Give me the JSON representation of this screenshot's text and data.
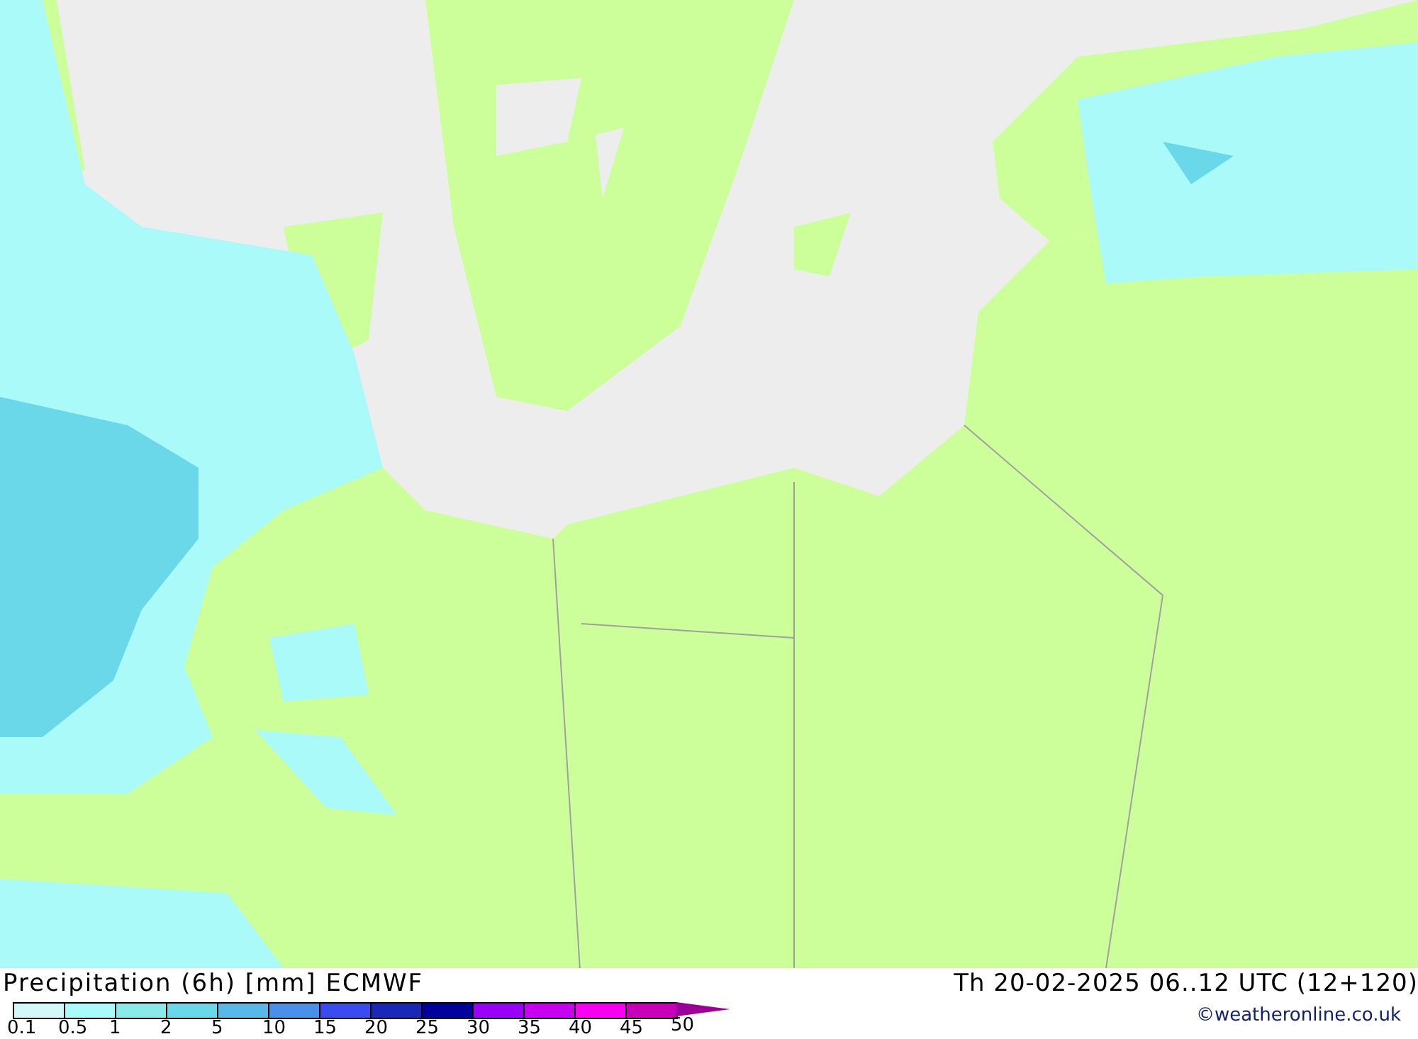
{
  "map": {
    "title": "Precipitation (6h) [mm] ECMWF",
    "valid_time": "Th 20-02-2025 06..12 UTC (12+120)"
  },
  "legend": [
    {
      "label": "0.1",
      "color": "#d2f8f8"
    },
    {
      "label": "0.5",
      "color": "#aafafa"
    },
    {
      "label": "1",
      "color": "#8aeaea"
    },
    {
      "label": "2",
      "color": "#6ad8e8"
    },
    {
      "label": "5",
      "color": "#5ab8e8"
    },
    {
      "label": "10",
      "color": "#4a90e8"
    },
    {
      "label": "15",
      "color": "#3a4cf0"
    },
    {
      "label": "20",
      "color": "#1a28b8"
    },
    {
      "label": "25",
      "color": "#00009a"
    },
    {
      "label": "30",
      "color": "#9a00f8"
    },
    {
      "label": "35",
      "color": "#c800f0"
    },
    {
      "label": "40",
      "color": "#f800f0"
    },
    {
      "label": "45",
      "color": "#c800b8"
    },
    {
      "label": "50",
      "color": "#9a0098"
    }
  ],
  "credit": "©weatheronline.co.uk"
}
